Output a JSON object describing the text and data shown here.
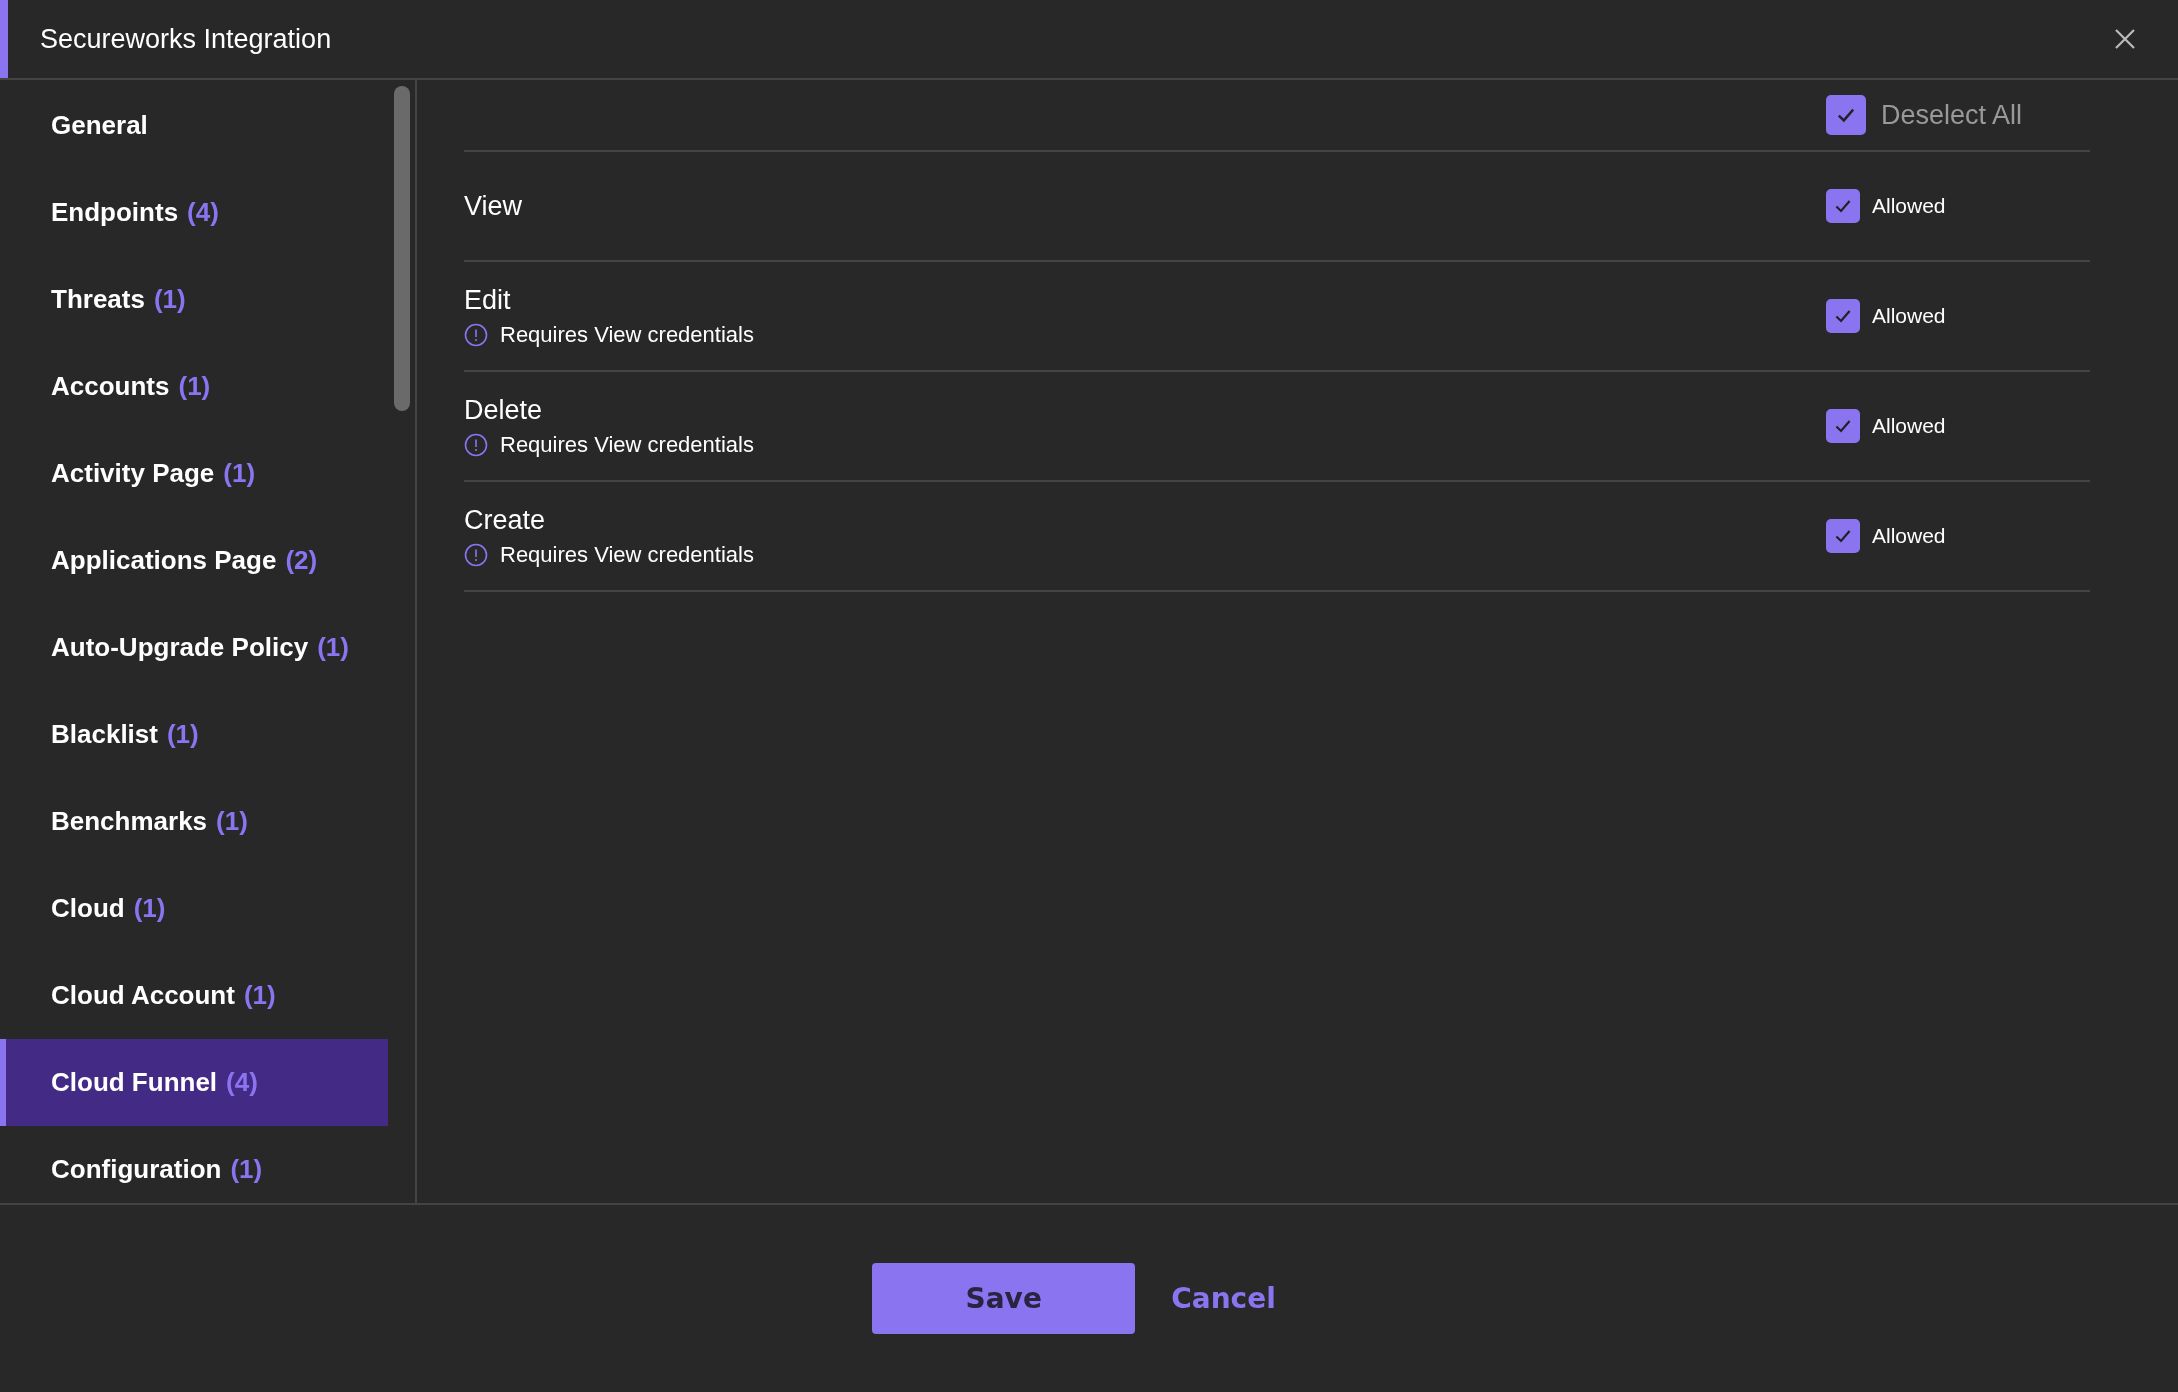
{
  "window": {
    "title": "Secureworks Integration"
  },
  "sidebar": {
    "items": [
      {
        "label": "General",
        "selected": false
      },
      {
        "label": "Endpoints",
        "count": "(4)",
        "selected": false
      },
      {
        "label": "Threats",
        "count": "(1)",
        "selected": false
      },
      {
        "label": "Accounts",
        "count": "(1)",
        "selected": false
      },
      {
        "label": "Activity Page",
        "count": "(1)",
        "selected": false
      },
      {
        "label": "Applications Page",
        "count": "(2)",
        "selected": false
      },
      {
        "label": "Auto-Upgrade Policy",
        "count": "(1)",
        "selected": false
      },
      {
        "label": "Blacklist",
        "count": "(1)",
        "selected": false
      },
      {
        "label": "Benchmarks",
        "count": "(1)",
        "selected": false
      },
      {
        "label": "Cloud",
        "count": "(1)",
        "selected": false
      },
      {
        "label": "Cloud Account",
        "count": "(1)",
        "selected": false
      },
      {
        "label": "Cloud Funnel",
        "count": "(4)",
        "selected": true
      },
      {
        "label": "Configuration",
        "count": "(1)",
        "selected": false
      }
    ]
  },
  "permissions": {
    "select_all": {
      "label": "Deselect All",
      "checked": true
    },
    "rows": [
      {
        "name": "View",
        "state_label": "Allowed",
        "checked": true
      },
      {
        "name": "Edit",
        "note": "Requires View credentials",
        "state_label": "Allowed",
        "checked": true
      },
      {
        "name": "Delete",
        "note": "Requires View credentials",
        "state_label": "Allowed",
        "checked": true
      },
      {
        "name": "Create",
        "note": "Requires View credentials",
        "state_label": "Allowed",
        "checked": true
      }
    ]
  },
  "footer": {
    "buttons": [
      {
        "label": "Save",
        "kind": "primary"
      },
      {
        "label": "Cancel",
        "kind": "link"
      }
    ]
  }
}
